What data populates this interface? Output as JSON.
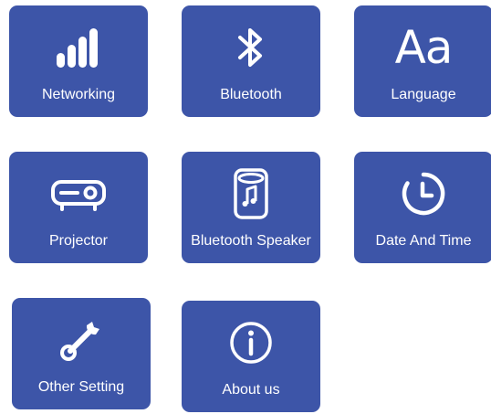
{
  "theme": {
    "tile_color": "#3d55a8",
    "text_color": "#ffffff"
  },
  "tiles": [
    {
      "label": "Networking",
      "icon": "signal-bars-icon"
    },
    {
      "label": "Bluetooth",
      "icon": "bluetooth-icon"
    },
    {
      "label": "Language",
      "icon": "language-icon",
      "glyph": "Aa"
    },
    {
      "label": "Projector",
      "icon": "projector-icon"
    },
    {
      "label": "Bluetooth Speaker",
      "icon": "speaker-icon"
    },
    {
      "label": "Date And Time",
      "icon": "clock-icon"
    },
    {
      "label": "Other Setting",
      "icon": "wrench-icon"
    },
    {
      "label": "About us",
      "icon": "info-icon"
    }
  ]
}
